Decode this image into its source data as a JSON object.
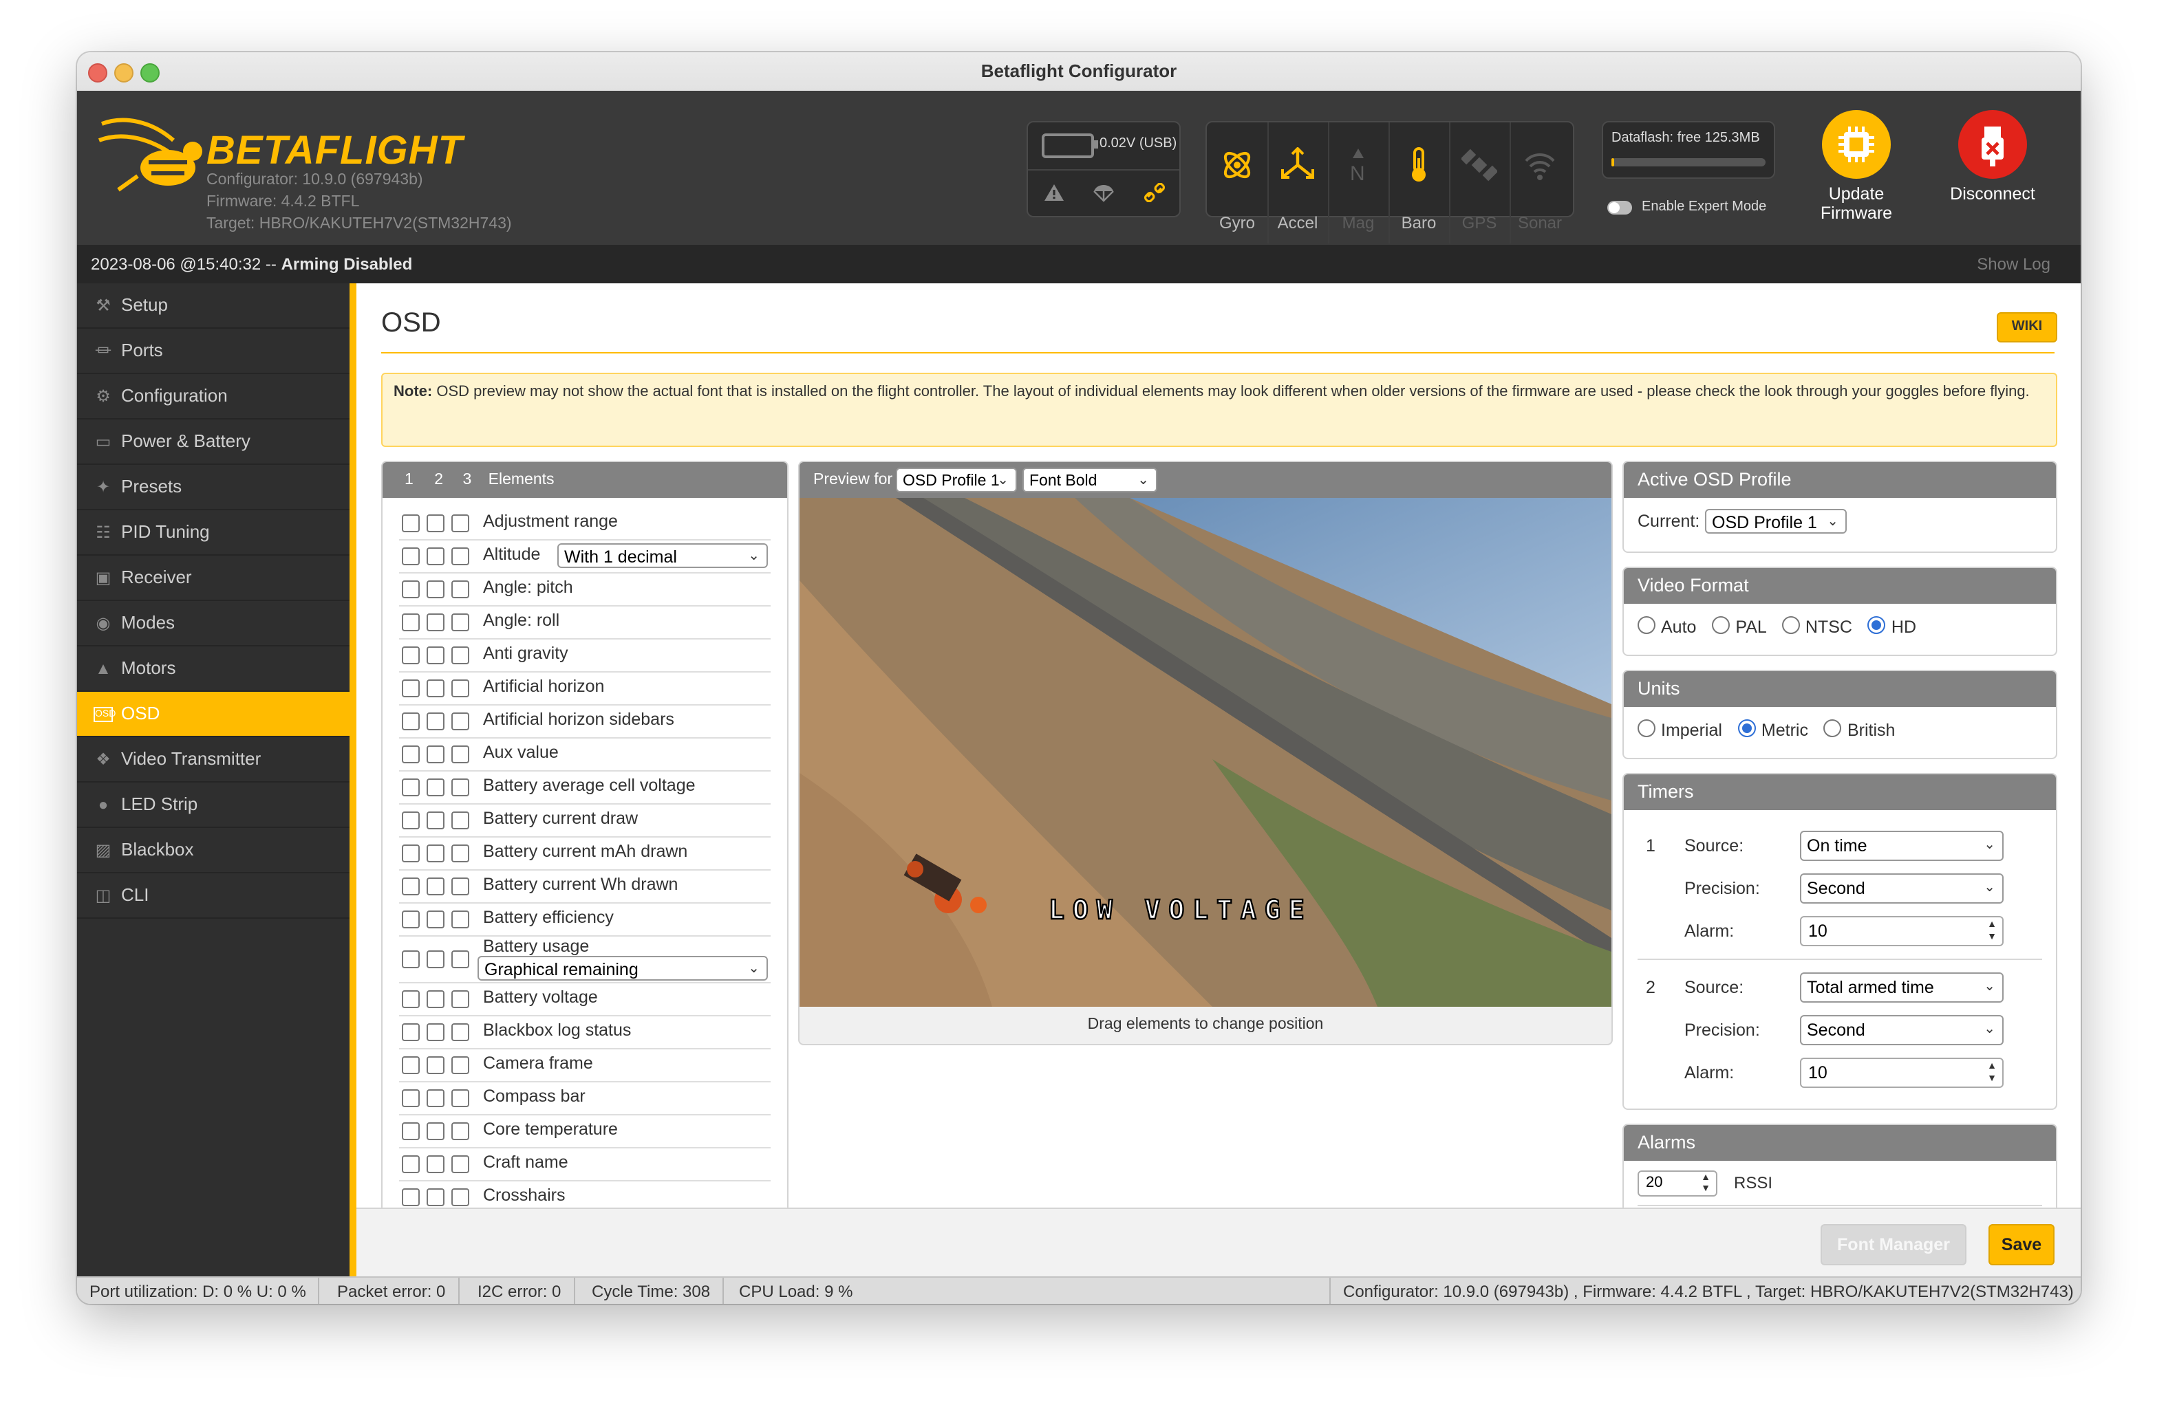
{
  "window": {
    "title": "Betaflight Configurator"
  },
  "header": {
    "logo_text": "BETAFLIGHT",
    "configurator_version": "Configurator: 10.9.0 (697943b)",
    "firmware": "Firmware: 4.4.2 BTFL",
    "target": "Target: HBRO/KAKUTEH7V2(STM32H743)",
    "battery_voltage": "0.02V (USB)",
    "sensors": [
      {
        "label": "Gyro",
        "icon": "gyro-icon",
        "active": true
      },
      {
        "label": "Accel",
        "icon": "accel-icon",
        "active": true
      },
      {
        "label": "Mag",
        "icon": "mag-icon",
        "active": false
      },
      {
        "label": "Baro",
        "icon": "baro-icon",
        "active": true
      },
      {
        "label": "GPS",
        "icon": "gps-icon",
        "active": false
      },
      {
        "label": "Sonar",
        "icon": "sonar-icon",
        "active": false
      }
    ],
    "dataflash": "Dataflash: free 125.3MB",
    "expert_mode_label": "Enable Expert Mode",
    "update_firmware_line1": "Update",
    "update_firmware_line2": "Firmware",
    "disconnect_label": "Disconnect",
    "accent_color": "#ffbb00",
    "disconnect_color": "#e2231a"
  },
  "logbar": {
    "timestamp": "2023-08-06 @15:40:32 -- ",
    "status": "Arming Disabled",
    "show_log": "Show Log"
  },
  "sidebar": {
    "items": [
      {
        "label": "Setup",
        "icon": "wrench-icon"
      },
      {
        "label": "Ports",
        "icon": "plug-icon"
      },
      {
        "label": "Configuration",
        "icon": "gear-icon"
      },
      {
        "label": "Power & Battery",
        "icon": "battery-icon"
      },
      {
        "label": "Presets",
        "icon": "wand-icon"
      },
      {
        "label": "PID Tuning",
        "icon": "sitemap-icon"
      },
      {
        "label": "Receiver",
        "icon": "receiver-icon"
      },
      {
        "label": "Modes",
        "icon": "toggles-icon"
      },
      {
        "label": "Motors",
        "icon": "motor-icon"
      },
      {
        "label": "OSD",
        "icon": "osd-icon",
        "active": true
      },
      {
        "label": "Video Transmitter",
        "icon": "broadcast-icon"
      },
      {
        "label": "LED Strip",
        "icon": "led-icon"
      },
      {
        "label": "Blackbox",
        "icon": "blackbox-icon"
      },
      {
        "label": "CLI",
        "icon": "terminal-icon"
      }
    ]
  },
  "main": {
    "title": "OSD",
    "wiki": "WIKI",
    "note_bold": "Note:",
    "note_text": " OSD preview may not show the actual font that is installed on the flight controller. The layout of individual elements may look different when older versions of the firmware are used - please check the look through your goggles before flying."
  },
  "elements_panel": {
    "header_tabs": [
      "1",
      "2",
      "3"
    ],
    "header_label": "Elements",
    "rows": [
      {
        "name": "Adjustment range"
      },
      {
        "name": "Altitude",
        "select": "With 1 decimal"
      },
      {
        "name": "Angle: pitch"
      },
      {
        "name": "Angle: roll"
      },
      {
        "name": "Anti gravity"
      },
      {
        "name": "Artificial horizon"
      },
      {
        "name": "Artificial horizon sidebars"
      },
      {
        "name": "Aux value"
      },
      {
        "name": "Battery average cell voltage"
      },
      {
        "name": "Battery current draw"
      },
      {
        "name": "Battery current mAh drawn"
      },
      {
        "name": "Battery current Wh drawn"
      },
      {
        "name": "Battery efficiency"
      },
      {
        "name": "Battery usage",
        "select": "Graphical remaining"
      },
      {
        "name": "Battery voltage"
      },
      {
        "name": "Blackbox log status"
      },
      {
        "name": "Camera frame"
      },
      {
        "name": "Compass bar"
      },
      {
        "name": "Core temperature"
      },
      {
        "name": "Craft name"
      },
      {
        "name": "Crosshairs"
      }
    ]
  },
  "preview": {
    "preview_for": "Preview for",
    "profile_select": "OSD Profile 1",
    "font_select": "Font Bold",
    "osd_warning": "LOW VOLTAGE",
    "hint": "Drag elements to change position"
  },
  "active_profile": {
    "title": "Active OSD Profile",
    "current_label": "Current:",
    "current_value": "OSD Profile 1"
  },
  "video_format": {
    "title": "Video Format",
    "options": [
      "Auto",
      "PAL",
      "NTSC",
      "HD"
    ],
    "selected": "HD"
  },
  "units": {
    "title": "Units",
    "options": [
      "Imperial",
      "Metric",
      "British"
    ],
    "selected": "Metric"
  },
  "timers": {
    "title": "Timers",
    "items": [
      {
        "index": "1",
        "source_label": "Source:",
        "source": "On time",
        "precision_label": "Precision:",
        "precision": "Second",
        "alarm_label": "Alarm:",
        "alarm": "10"
      },
      {
        "index": "2",
        "source_label": "Source:",
        "source": "Total armed time",
        "precision_label": "Precision:",
        "precision": "Second",
        "alarm_label": "Alarm:",
        "alarm": "10"
      }
    ]
  },
  "alarms": {
    "title": "Alarms",
    "rssi_value": "20",
    "rssi_label": "RSSI"
  },
  "buttons": {
    "font_manager": "Font Manager",
    "save": "Save"
  },
  "statusbar": {
    "port_util": "Port utilization: D: 0 % U: 0 %",
    "packet_error": "Packet error: 0",
    "i2c_error": "I2C error: 0",
    "cycle_time": "Cycle Time: 308",
    "cpu_load": "CPU Load: 9 %",
    "version": "Configurator: 10.9.0 (697943b) , Firmware: 4.4.2 BTFL , Target: HBRO/KAKUTEH7V2(STM32H743)"
  }
}
